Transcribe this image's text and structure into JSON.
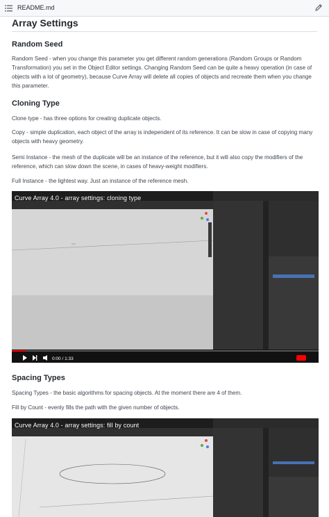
{
  "file": {
    "name": "README.md"
  },
  "section": {
    "title": "Array Settings"
  },
  "random_seed": {
    "heading": "Random Seed",
    "text": "Random Seed - when you change this parameter you get different random generations (Random Groups or Random Transformation) you set in the Object Editor settings. Changing Random Seed can be quite a heavy operation (in case of objects with a lot of geometry), because Curve Array will delete all copies of objects and recreate them when you change this parameter."
  },
  "cloning": {
    "heading": "Cloning Type",
    "intro": "Clone type - has three options for creating duplicate objects.",
    "copy": "Copy - simple duplication, each object of the array is independent of its reference. It can be slow in case of copying many objects with heavy geometry.",
    "semi": "Semi Instance - the mesh of the duplicate will be an instance of the reference, but it will also copy the modifiers of the reference, which can slow down the scene, in cases of heavy-weight modifiers.",
    "full": "Full Instance - the lightest way. Just an instance of the reference mesh."
  },
  "video1": {
    "title": "Curve Array 4.0 - array settings: cloning type",
    "time": "0:00 / 1:33"
  },
  "spacing": {
    "heading": "Spacing Types",
    "intro": "Spacing Types - the basic algorithms for spacing objects. At the moment there are 4 of them.",
    "fill": "Fill by Count - evenly fills the path with the given number of objects."
  },
  "video2": {
    "title": "Curve Array 4.0 - array settings: fill by count"
  },
  "colors": {
    "accent": "#ff0000",
    "viewport": "#3d3d3d",
    "cube": "#7fb6d6",
    "outline": "#e09a30"
  }
}
